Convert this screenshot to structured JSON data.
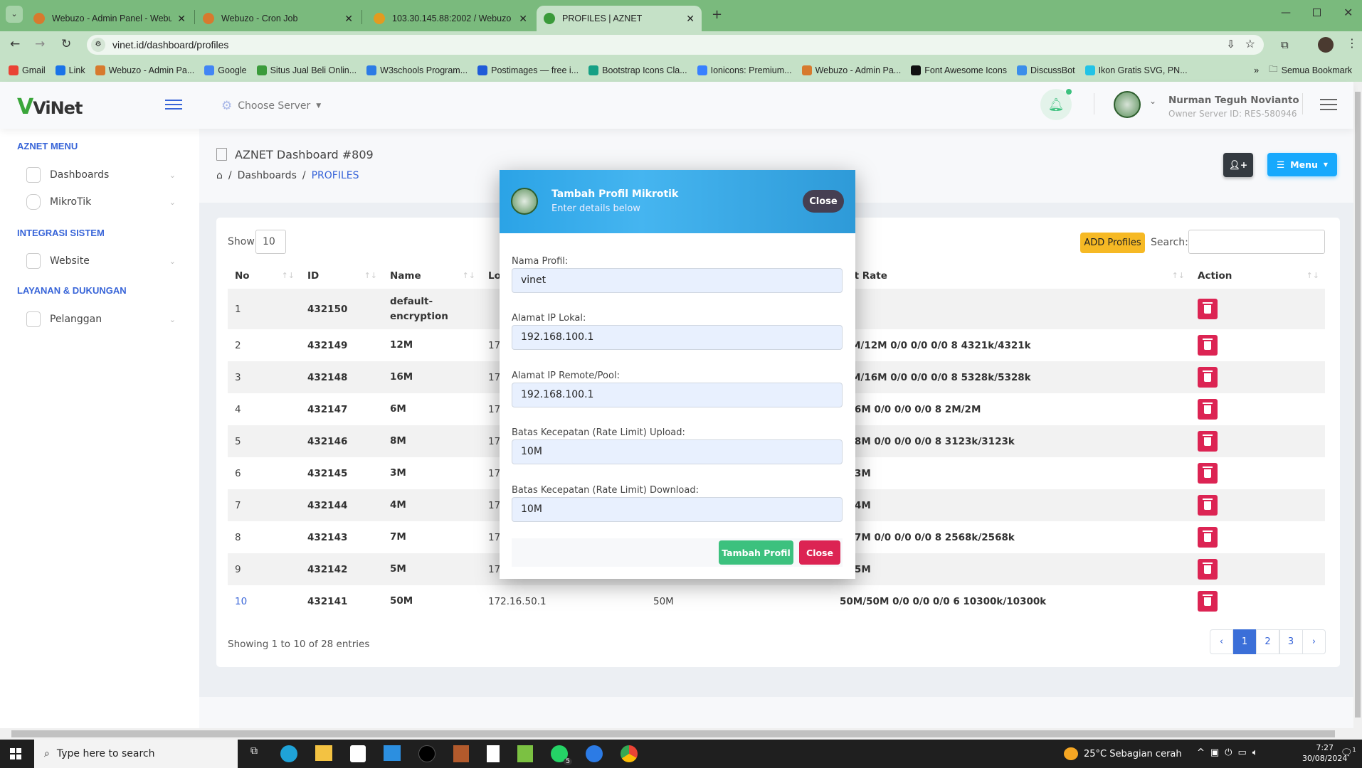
{
  "browser": {
    "tabs": [
      {
        "title": "Webuzo - Admin Panel - Webuzo",
        "icon": "webuzo-icon",
        "color": "#d77a2e"
      },
      {
        "title": "Webuzo - Cron Job",
        "icon": "webuzo-icon",
        "color": "#d77a2e"
      },
      {
        "title": "103.30.145.88:2002 / Webuzo S",
        "icon": "pma-icon",
        "color": "#e39b20"
      },
      {
        "title": "PROFILES | AZNET",
        "icon": "check-icon",
        "color": "#3a9a3a",
        "active": true
      }
    ],
    "url": "vinet.id/dashboard/profiles",
    "bookmarks": [
      {
        "label": "Gmail",
        "color": "#ea4335"
      },
      {
        "label": "Link",
        "color": "#1a73e8"
      },
      {
        "label": "Webuzo - Admin Pa...",
        "color": "#d77a2e"
      },
      {
        "label": "Google",
        "color": "#4285f4"
      },
      {
        "label": "Situs Jual Beli Onlin...",
        "color": "#3b9b3b"
      },
      {
        "label": "W3schools Program...",
        "color": "#2c7be5"
      },
      {
        "label": "Postimages — free i...",
        "color": "#1f5bd8"
      },
      {
        "label": "Bootstrap Icons Cla...",
        "color": "#16a085"
      },
      {
        "label": "Ionicons: Premium...",
        "color": "#3880ff"
      },
      {
        "label": "Webuzo - Admin Pa...",
        "color": "#d77a2e"
      },
      {
        "label": "Font Awesome Icons",
        "color": "#111111"
      },
      {
        "label": "DiscussBot",
        "color": "#3b8eea"
      },
      {
        "label": "Ikon Gratis SVG, PN...",
        "color": "#22c3e6"
      }
    ],
    "more": "»",
    "all_bookmarks": "Semua Bookmark"
  },
  "header": {
    "logo": "ViNet",
    "server_select": "Choose Server",
    "user_name": "Nurman Teguh Novianto",
    "user_sub": "Owner Server ID: RES-580946"
  },
  "sidebar": {
    "sections": [
      {
        "title": "AZNET MENU",
        "items": [
          {
            "label": "Dashboards",
            "icon": "rocket-icon"
          },
          {
            "label": "MikroTik",
            "icon": "database-icon"
          }
        ]
      },
      {
        "title": "INTEGRASI SISTEM",
        "items": [
          {
            "label": "Website",
            "icon": "image-icon"
          }
        ]
      },
      {
        "title": "LAYANAN & DUKUNGAN",
        "items": [
          {
            "label": "Pelanggan",
            "icon": "users-icon"
          }
        ]
      }
    ]
  },
  "page": {
    "title": "AZNET Dashboard #809",
    "breadcrumb": [
      "Dashboards",
      "PROFILES"
    ],
    "menu_button": "Menu"
  },
  "table": {
    "show_label": "Show",
    "show_value": "10",
    "add_button": "ADD Profiles",
    "search_label": "Search:",
    "search_value": "",
    "columns": [
      "No",
      "ID",
      "Name",
      "Lo",
      "",
      "it Rate",
      "Action"
    ],
    "rows": [
      {
        "no": "1",
        "id": "432150",
        "name": "default-encryption",
        "local": "",
        "remote": "",
        "rate": ""
      },
      {
        "no": "2",
        "id": "432149",
        "name": "12M",
        "local": "17.",
        "remote": "",
        "rate": "M/12M 0/0 0/0 0/0 8 4321k/4321k"
      },
      {
        "no": "3",
        "id": "432148",
        "name": "16M",
        "local": "17.",
        "remote": "",
        "rate": "M/16M 0/0 0/0 0/0 8 5328k/5328k"
      },
      {
        "no": "4",
        "id": "432147",
        "name": "6M",
        "local": "17.",
        "remote": "",
        "rate": "/6M 0/0 0/0 0/0 8 2M/2M"
      },
      {
        "no": "5",
        "id": "432146",
        "name": "8M",
        "local": "17.",
        "remote": "",
        "rate": "/8M 0/0 0/0 0/0 8 3123k/3123k"
      },
      {
        "no": "6",
        "id": "432145",
        "name": "3M",
        "local": "17.",
        "remote": "",
        "rate": "/3M"
      },
      {
        "no": "7",
        "id": "432144",
        "name": "4M",
        "local": "17.",
        "remote": "",
        "rate": "/4M"
      },
      {
        "no": "8",
        "id": "432143",
        "name": "7M",
        "local": "17.",
        "remote": "",
        "rate": "/7M 0/0 0/0 0/0 8 2568k/2568k"
      },
      {
        "no": "9",
        "id": "432142",
        "name": "5M",
        "local": "17.",
        "remote": "",
        "rate": "/5M"
      },
      {
        "no": "10",
        "id": "432141",
        "name": "50M",
        "local": "172.16.50.1",
        "remote": "50M",
        "rate": "50M/50M 0/0 0/0 0/0 6 10300k/10300k"
      }
    ],
    "info": "Showing 1 to 10 of 28 entries",
    "pagination": {
      "prev": "‹",
      "pages": [
        "1",
        "2",
        "3"
      ],
      "current": "1",
      "next": "›"
    }
  },
  "modal": {
    "title": "Tambah Profil Mikrotik",
    "subtitle": "Enter details below",
    "close_top": "Close",
    "fields": [
      {
        "label": "Nama Profil:",
        "value": "vinet"
      },
      {
        "label": "Alamat IP Lokal:",
        "value": "192.168.100.1"
      },
      {
        "label": "Alamat IP Remote/Pool:",
        "value": "192.168.100.1"
      },
      {
        "label": "Batas Kecepatan (Rate Limit) Upload:",
        "value": "10M"
      },
      {
        "label": "Batas Kecepatan (Rate Limit) Download:",
        "value": "10M"
      }
    ],
    "submit": "Tambah Profil",
    "close": "Close"
  },
  "taskbar": {
    "search_placeholder": "Type here to search",
    "weather": "25°C  Sebagian cerah",
    "time": "7:27",
    "date": "30/08/2024",
    "whatsapp_badge": "5",
    "notification_count": "1"
  },
  "colors": {
    "accent": "#3764d8",
    "danger": "#dc2453",
    "success": "#3cc17e",
    "warning": "#f6b924",
    "info": "#17a9fd"
  }
}
